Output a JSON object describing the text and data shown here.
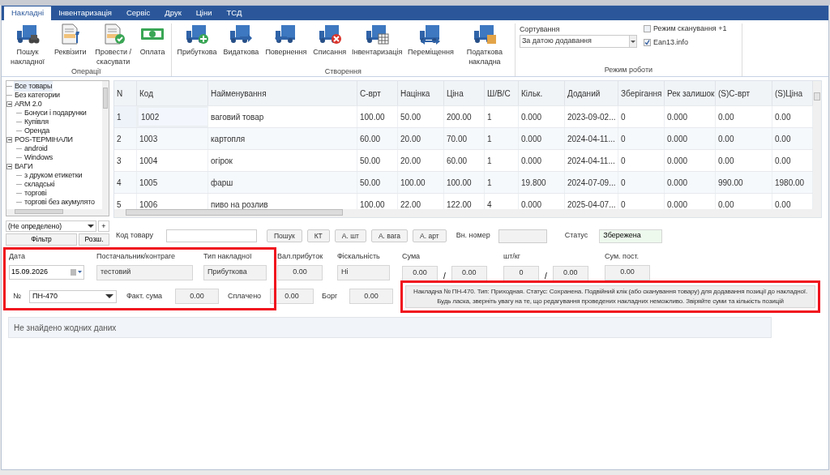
{
  "tabs": [
    {
      "label": "Накладні",
      "selected": true
    },
    {
      "label": "Інвентаризація",
      "selected": false
    },
    {
      "label": "Сервіс",
      "selected": false
    },
    {
      "label": "Друк",
      "selected": false
    },
    {
      "label": "Ціни",
      "selected": false
    },
    {
      "label": "ТСД",
      "selected": false
    }
  ],
  "ribbon": {
    "groups": [
      {
        "title": "Операції",
        "buttons": [
          "Пошук накладної",
          "Реквізити",
          "Провести / скасувати",
          "Оплата"
        ]
      },
      {
        "title": "Створення",
        "buttons": [
          "Прибуткова",
          "Видаткова",
          "Повернення",
          "Списання",
          "Інвентаризація",
          "Переміщення",
          "Податкова накладна"
        ]
      }
    ],
    "mode": {
      "title": "Режим роботи",
      "sorting_label": "Сортування",
      "sorting_value": "За датою додавання",
      "checkboxes": [
        {
          "label": "Режим сканування +1",
          "checked": false
        },
        {
          "label": "Ean13.info",
          "checked": true
        }
      ]
    }
  },
  "tree": [
    {
      "label": "Все товары",
      "selected": true
    },
    {
      "label": "Без категории",
      "selected": false
    },
    {
      "label": "ARM 2.0",
      "selected": false,
      "expanded": true,
      "children": [
        {
          "label": "Бонуси і подарунки",
          "selected": false
        },
        {
          "label": "Купівля",
          "selected": false
        },
        {
          "label": "Оренда",
          "selected": false
        }
      ]
    },
    {
      "label": "POS-ТЕРМІНАЛИ",
      "selected": false,
      "expanded": true,
      "children": [
        {
          "label": "android",
          "selected": false
        },
        {
          "label": "Windows",
          "selected": false
        }
      ]
    },
    {
      "label": "ВАГИ",
      "selected": false,
      "expanded": true,
      "children": [
        {
          "label": "з друком етикетки",
          "selected": false
        },
        {
          "label": "складські",
          "selected": false
        },
        {
          "label": "торгові",
          "selected": false
        },
        {
          "label": "торгові без акумулято",
          "selected": false
        }
      ]
    }
  ],
  "filter": {
    "value": "(Не определено)",
    "add": "+",
    "buttons": [
      "Фільтр",
      "Розш."
    ]
  },
  "table": {
    "columns": [
      "N",
      "Код",
      "Найменування",
      "С-врт",
      "Націнка",
      "Ціна",
      "Ш/В/С",
      "Кільк.",
      "Доданий",
      "Зберігання",
      "Рек залишок",
      "(S)C-врт",
      "(S)Ціна"
    ],
    "rows": [
      {
        "selected": true,
        "cells": [
          "1",
          "1002",
          "ваговий товар",
          "100.00",
          "50.00",
          "200.00",
          "1",
          "0.000",
          "2023-09-02...",
          "0",
          "0.000",
          "0.00",
          "0.00"
        ]
      },
      {
        "selected": false,
        "cells": [
          "2",
          "1003",
          "картопля",
          "60.00",
          "20.00",
          "70.00",
          "1",
          "0.000",
          "2024-04-11...",
          "0",
          "0.000",
          "0.00",
          "0.00"
        ]
      },
      {
        "selected": false,
        "cells": [
          "3",
          "1004",
          "огірок",
          "50.00",
          "20.00",
          "60.00",
          "1",
          "0.000",
          "2024-04-11...",
          "0",
          "0.000",
          "0.00",
          "0.00"
        ]
      },
      {
        "selected": false,
        "cells": [
          "4",
          "1005",
          "фарш",
          "50.00",
          "100.00",
          "100.00",
          "1",
          "19.800",
          "2024-07-09...",
          "0",
          "0.000",
          "990.00",
          "1980.00"
        ]
      },
      {
        "selected": false,
        "cells": [
          "5",
          "1006",
          "пиво на розлив",
          "100.00",
          "22.00",
          "122.00",
          "4",
          "0.000",
          "2025-04-07...",
          "0",
          "0.000",
          "0.00",
          "0.00"
        ]
      }
    ]
  },
  "search_bar": {
    "code_label": "Код товару",
    "buttons": [
      "Пошук",
      "КТ",
      "А. шт",
      "А. вага",
      "А. арт"
    ],
    "ext_number_label": "Вн. номер",
    "status_label": "Статус",
    "status_value": "Збережена"
  },
  "invoice_header": {
    "highlighted": true,
    "date": {
      "label": "Дата",
      "value": "15.09.2026"
    },
    "supplier": {
      "label": "Постачальник/контраге",
      "value": "тестовий"
    },
    "type": {
      "label": "Тип накладної",
      "value": "Прибуткова"
    },
    "number": {
      "label": "№",
      "value": "ПН-470"
    },
    "actual_sum": {
      "label": "Факт. сума",
      "value": "0.00"
    }
  },
  "summary": [
    {
      "label": "Вал.прибуток",
      "kind": "number",
      "values": [
        "0.00"
      ]
    },
    {
      "label": "Фіскальність",
      "kind": "text",
      "values": [
        "Ні"
      ]
    },
    {
      "label": "Сума",
      "kind": "number",
      "values": [
        "0.00",
        "0.00"
      ],
      "separator": "/"
    },
    {
      "label": "шт/кг",
      "kind": "number",
      "values": [
        "0",
        "0.00"
      ],
      "separator": "/"
    },
    {
      "label": "Сум. пост.",
      "kind": "number",
      "values": [
        "0.00"
      ]
    }
  ],
  "payments": [
    {
      "label": "Сплачено",
      "value": "0.00"
    },
    {
      "label": "Борг",
      "value": "0.00"
    }
  ],
  "message": {
    "highlighted": true,
    "text": "Накладна № ПН-470. Тип: Приходная. Статус: Сохранена. Подвійний клік (або сканування товару) для додавання позиції до накладної. Будь ласка, зверніть увагу на те, що редагування проведених накладних неможливо. Звіряйте суми та кількість позицій"
  },
  "positions": {
    "empty_text": "Не знайдено жодних даних"
  }
}
